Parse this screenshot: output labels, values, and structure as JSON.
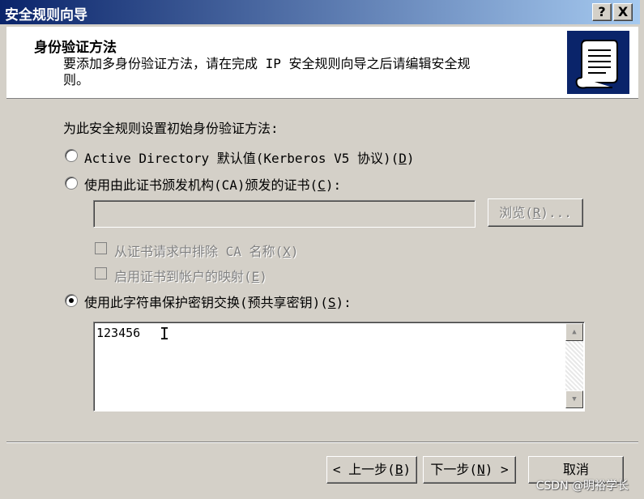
{
  "window": {
    "title": "安全规则向导",
    "help_btn": "?",
    "close_btn": "X"
  },
  "header": {
    "title": "身份验证方法",
    "desc_line1": "要添加多身份验证方法，请在完成 IP 安全规则向导之后请编辑安全规",
    "desc_line2": "则。"
  },
  "body": {
    "prompt": "为此安全规则设置初始身份验证方法:",
    "option_ad": {
      "text": "Active Directory 默认值(Kerberos V5 协议)(",
      "key": "D",
      "end": ")"
    },
    "option_ca": {
      "text": "使用由此证书颁发机构(CA)颁发的证书(",
      "key": "C",
      "end": "):"
    },
    "ca_field_value": "",
    "browse": {
      "text": "浏览(",
      "key": "R",
      "end": ")..."
    },
    "exclude_ca": {
      "text": "从证书请求中排除 CA 名称(",
      "key": "X",
      "end": ")"
    },
    "enable_mapping": {
      "text": "启用证书到帐户的映射(",
      "key": "E",
      "end": ")"
    },
    "option_psk": {
      "text": "使用此字符串保护密钥交换(预共享密钥)(",
      "key": "S",
      "end": "):"
    },
    "psk_value": "123456"
  },
  "footer": {
    "back": {
      "text": "< 上一步(",
      "key": "B",
      "end": ")"
    },
    "next": {
      "text": "下一步(",
      "key": "N",
      "end": ") >"
    },
    "cancel": "取消"
  },
  "watermark": "CSDN @明裕学长",
  "selected_option": "psk"
}
